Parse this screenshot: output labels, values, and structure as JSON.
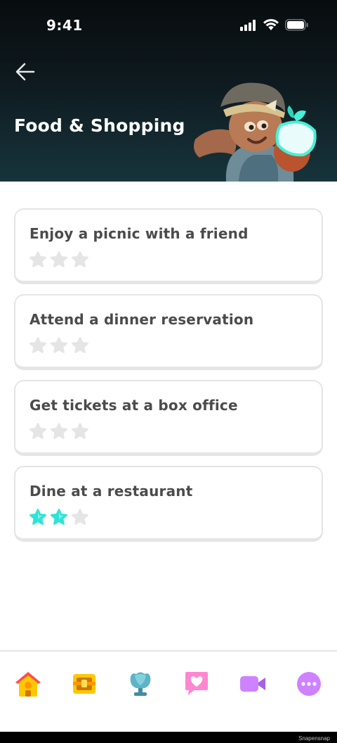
{
  "status_bar": {
    "time": "9:41",
    "icons": [
      "cellular-signal-icon",
      "wifi-icon",
      "battery-icon"
    ]
  },
  "header": {
    "back_icon": "back-arrow-icon",
    "title": "Food & Shopping",
    "illustration": "character-with-glowing-bag"
  },
  "scenes": [
    {
      "title": "Enjoy a picnic with a friend",
      "stars_earned": 0,
      "stars_total": 3
    },
    {
      "title": "Attend a dinner reservation",
      "stars_earned": 0,
      "stars_total": 3
    },
    {
      "title": "Get tickets at a box office",
      "stars_earned": 0,
      "stars_total": 3
    },
    {
      "title": "Dine at a restaurant",
      "stars_earned": 2,
      "stars_total": 3
    }
  ],
  "tab_bar": {
    "tabs": [
      {
        "name": "home",
        "icon": "home-icon"
      },
      {
        "name": "chest",
        "icon": "treasure-chest-icon"
      },
      {
        "name": "league",
        "icon": "trophy-icon"
      },
      {
        "name": "health",
        "icon": "heart-message-icon"
      },
      {
        "name": "video",
        "icon": "video-camera-icon"
      },
      {
        "name": "more",
        "icon": "more-icon"
      }
    ]
  },
  "colors": {
    "star_earned": "#2fe3d6",
    "star_empty": "#e5e5e5",
    "card_border": "#e5e5e5",
    "text": "#4b4b4b"
  },
  "watermark": "Snapensnap"
}
